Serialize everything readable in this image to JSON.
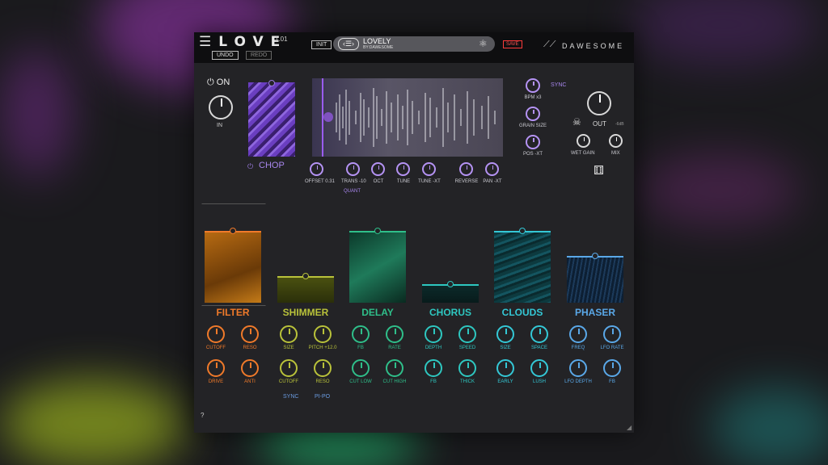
{
  "app": {
    "name": "LOVE",
    "version": "1.01",
    "brand": "DAWESOME"
  },
  "header": {
    "undo": "UNDO",
    "redo": "REDO",
    "init": "INIT",
    "preset_name": "LOVELY",
    "preset_author": "BY:DAWESOME",
    "save": "SAVE"
  },
  "input": {
    "power_label": "ON",
    "knob_label": "IN"
  },
  "chop": {
    "label": "CHOP"
  },
  "sample_knobs": [
    "OFFSET 0.31",
    "TRANS -10",
    "OCT",
    "TUNE",
    "TUNE -XT",
    "REVERSE",
    "PAN -XT"
  ],
  "quant_label": "QUANT",
  "right_col": {
    "sync": "SYNC",
    "knobs": [
      "BPM x3",
      "GRAIN SIZE",
      "POS -XT"
    ]
  },
  "output": {
    "label": "OUT",
    "db": "-6dB",
    "wet_gain": "WET GAIN",
    "mix": "MIX"
  },
  "effects": [
    {
      "name": "FILTER",
      "color": "#f07a2a",
      "knobs": [
        "CUTOFF",
        "RESO",
        "DRIVE",
        "ANTI"
      ],
      "level": 1.0
    },
    {
      "name": "SHIMMER",
      "color": "#b9c23a",
      "knobs": [
        "SIZE",
        "PITCH +12.0",
        "CUTOFF",
        "RESO"
      ],
      "level": 0.36
    },
    {
      "name": "DELAY",
      "color": "#2fbf8a",
      "knobs": [
        "FB",
        "RATE",
        "CUT LOW",
        "CUT HIGH"
      ],
      "level": 1.0
    },
    {
      "name": "CHORUS",
      "color": "#2ec7c0",
      "knobs": [
        "DEPTH",
        "SPEED",
        "FB",
        "THICK"
      ],
      "level": 0.24
    },
    {
      "name": "CLOUDS",
      "color": "#34c8d6",
      "knobs": [
        "SIZE",
        "SPACE",
        "EARLY",
        "LUSH"
      ],
      "level": 1.0
    },
    {
      "name": "PHASER",
      "color": "#5aa8e8",
      "knobs": [
        "FREQ",
        "LFO RATE",
        "LFO DEPTH",
        "FB"
      ],
      "level": 0.64
    }
  ],
  "delay_extra": [
    "SYNC",
    "PI-PO"
  ],
  "help": "?",
  "colors": {
    "accent": "#9b5cf0",
    "panel": "#232326",
    "topbar": "#0e0e10"
  }
}
